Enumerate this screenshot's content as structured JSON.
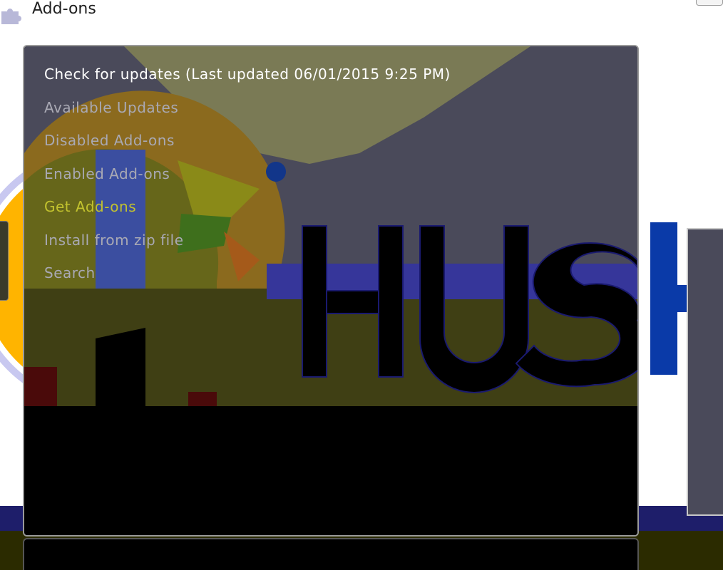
{
  "header": {
    "title": "Add-ons",
    "icon": "addons-puzzle-icon"
  },
  "background": {
    "logo_text": "HUSH"
  },
  "menu": {
    "items": [
      {
        "label": "Check for updates (Last updated 06/01/2015 9:25 PM)",
        "state": "normal"
      },
      {
        "label": "Available Updates",
        "state": "normal"
      },
      {
        "label": "Disabled Add-ons",
        "state": "normal"
      },
      {
        "label": "Enabled Add-ons",
        "state": "normal"
      },
      {
        "label": "Get Add-ons",
        "state": "focused"
      },
      {
        "label": "Install from zip file",
        "state": "normal"
      },
      {
        "label": "Search",
        "state": "normal"
      }
    ]
  },
  "colors": {
    "menu_text": "#a9a9b4",
    "menu_first": "#ffffff",
    "menu_focused": "#c2c22e",
    "panel_bg": "#4a4a5a"
  }
}
